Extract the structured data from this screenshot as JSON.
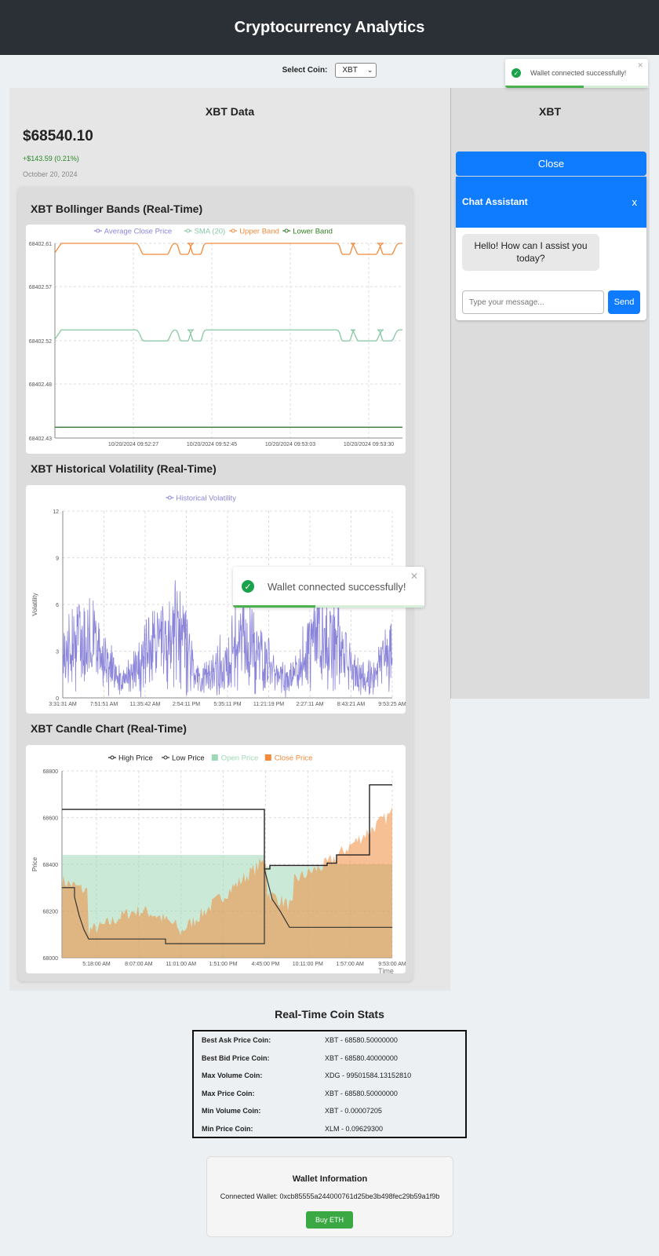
{
  "header": {
    "title": "Cryptocurrency Analytics"
  },
  "coin_selector": {
    "label": "Select Coin:",
    "selected": "XBT"
  },
  "coin_data": {
    "title": "XBT Data",
    "price": "$68540.10",
    "change": "+$143.59 (0.21%)",
    "date": "October 20, 2024"
  },
  "charts": {
    "bollinger_title": "XBT Bollinger Bands (Real-Time)",
    "volatility_title": "XBT Historical Volatility (Real-Time)",
    "candle_title": "XBT Candle Chart (Real-Time)"
  },
  "chart_data": [
    {
      "type": "line",
      "title": "XBT Bollinger Bands (Real-Time)",
      "legend": [
        "Average Close Price",
        "SMA (20)",
        "Upper Band",
        "Lower Band"
      ],
      "colors": [
        "#8b85d9",
        "#86c9a3",
        "#f08a3c",
        "#2e7d1f"
      ],
      "x_ticks": [
        "10/20/2024 09:52:27",
        "10/20/2024 09:52:45",
        "10/20/2024 09:53:03",
        "10/20/2024 09:53:30"
      ],
      "y_ticks": [
        "68402.61",
        "68402.57",
        "68402.52",
        "68402.48",
        "68402.43"
      ],
      "ylim": [
        68402.43,
        68402.61
      ],
      "series": [
        {
          "name": "Upper Band",
          "values": [
            68402.596,
            68402.61,
            68402.61,
            68402.61,
            68402.61,
            68402.61,
            68402.61,
            68402.61,
            68402.61,
            68402.61,
            68402.61,
            68402.61,
            68402.61,
            68402.61,
            68402.61,
            68402.61,
            68402.61,
            68402.61,
            68402.61,
            68402.61,
            68402.61,
            68402.61,
            68402.61,
            68402.61,
            68402.61,
            68402.61,
            68402.61,
            68402.61,
            68402.61,
            68402.61,
            68402.61,
            68402.61,
            68402.61,
            68402.61,
            68402.61,
            68402.61,
            68402.61,
            68402.61,
            68402.61,
            68402.61,
            68402.61,
            68402.61,
            68402.61,
            68402.61,
            68402.61,
            68402.61,
            68402.61,
            68402.61,
            68402.61,
            68402.61,
            68402.61,
            68402.61,
            68402.61,
            68402.61,
            68402.61,
            68402.61,
            68402.61,
            68402.61,
            68402.61,
            68402.61,
            68402.61,
            68402.61,
            68402.61,
            68402.61,
            68402.61,
            68402.61,
            68402.61,
            68402.61,
            68402.61,
            68402.61,
            68402.61,
            68402.61,
            68402.61,
            68402.61,
            68402.61,
            68402.61,
            68402.61,
            68402.61,
            68402.61,
            68402.61,
            68402.61,
            68402.61,
            68402.61,
            68402.61,
            68402.61,
            68402.61,
            68402.61,
            68402.61,
            68402.61,
            68402.61,
            68402.61,
            68402.61,
            68402.61,
            68402.61,
            68402.61,
            68402.61,
            68402.61,
            68402.61,
            68402.61,
            68402.61,
            68402.61
          ]
        },
        {
          "name": "SMA (20)",
          "values": [
            68402.53,
            68402.53,
            68402.53,
            68402.53
          ]
        },
        {
          "name": "Average Close Price",
          "values": [
            68402.44,
            68402.44,
            68402.44,
            68402.44
          ]
        },
        {
          "name": "Lower Band",
          "values": [
            68402.44,
            68402.44,
            68402.44,
            68402.44
          ]
        }
      ]
    },
    {
      "type": "line",
      "title": "XBT Historical Volatility (Real-Time)",
      "legend": [
        "Historical Volatility"
      ],
      "colors": [
        "#8b85d9"
      ],
      "ylabel": "Volatility",
      "ylim": [
        0,
        12
      ],
      "y_ticks": [
        "12",
        "9",
        "6",
        "3",
        "0"
      ],
      "x_ticks": [
        "3:31:31 AM",
        "7:51:51 AM",
        "11:35:42 AM",
        "2:54:11 PM",
        "5:35:11 PM",
        "11:21:19 PM",
        "2:27:11 AM",
        "8:43:21 AM",
        "9:53:25 AM"
      ]
    },
    {
      "type": "bar",
      "title": "XBT Candle Chart (Real-Time)",
      "legend": [
        "High Price",
        "Low Price",
        "Open Price",
        "Close Price"
      ],
      "colors": [
        "#222222",
        "#333333",
        "#9fd8b6",
        "#f08a3c"
      ],
      "ylabel": "Price",
      "xlabel": "Time",
      "ylim": [
        68000,
        68800
      ],
      "y_ticks": [
        "68800",
        "68600",
        "68400",
        "68200",
        "68000"
      ],
      "x_ticks": [
        "5:18:00 AM",
        "8:07:00 AM",
        "11:01:00 AM",
        "1:51:00 PM",
        "4:45:00 PM",
        "10:11:00 PM",
        "1:57:00 AM",
        "9:53:00 AM"
      ]
    }
  ],
  "side_panel": {
    "coin": "XBT",
    "close_label": "Close",
    "chat": {
      "title": "Chat Assistant",
      "close_x": "x",
      "greeting": "Hello! How can I assist you today?",
      "input_placeholder": "Type your message...",
      "send_label": "Send"
    }
  },
  "toasts": {
    "small": {
      "message": "Wallet connected successfully!",
      "close": "✕",
      "progress": 0.55
    },
    "large": {
      "message": "Wallet connected successfully!",
      "close": "✕",
      "progress": 0.43
    }
  },
  "stats": {
    "title": "Real-Time Coin Stats",
    "rows": [
      {
        "key": "Best Ask Price Coin:",
        "value": "XBT - 68580.50000000"
      },
      {
        "key": "Best Bid Price Coin:",
        "value": "XBT - 68580.40000000"
      },
      {
        "key": "Max Volume Coin:",
        "value": "XDG - 99501584.13152810"
      },
      {
        "key": "Max Price Coin:",
        "value": "XBT - 68580.50000000"
      },
      {
        "key": "Min Volume Coin:",
        "value": "XBT - 0.00007205"
      },
      {
        "key": "Min Price Coin:",
        "value": "XLM - 0.09629300"
      }
    ]
  },
  "wallet": {
    "title": "Wallet Information",
    "address": "Connected Wallet: 0xcb85555a244000761d25be3b498fec29b59a1f9b",
    "buy_label": "Buy ETH"
  }
}
